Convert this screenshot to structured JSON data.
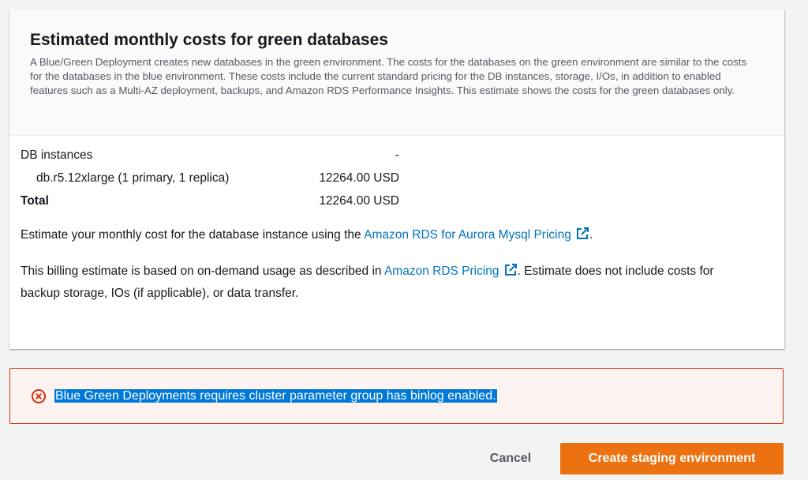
{
  "cost_panel": {
    "title": "Estimated monthly costs for green databases",
    "description": "A Blue/Green Deployment creates new databases in the green environment. The costs for the databases on the green environment are similar to the costs for the databases in the blue environment. These costs include the current standard pricing for the DB instances, storage, I/Os, in addition to enabled features such as a Multi-AZ deployment, backups, and Amazon RDS Performance Insights. This estimate shows the costs for the green databases only.",
    "rows": [
      {
        "label": "DB instances",
        "value": "-"
      },
      {
        "label": "db.r5.12xlarge (1 primary, 1 replica)",
        "value": "12264.00 USD"
      },
      {
        "label": "Total",
        "value": "12264.00 USD"
      }
    ],
    "estimate_text": "Estimate your monthly cost for the database instance using the",
    "estimate_link": "Amazon RDS for Aurora Mysql Pricing",
    "estimate_end": ".",
    "billing_text_before": "This billing estimate is based on on-demand usage as described in",
    "billing_link": "Amazon RDS Pricing",
    "billing_text_after": ". Estimate does not include costs for backup storage, IOs (if applicable), or data transfer.",
    "external_icon": "external-link-icon"
  },
  "alert": {
    "icon": "error-circle-x-icon",
    "message": "Blue Green Deployments requires cluster parameter group has binlog enabled."
  },
  "actions": {
    "cancel_label": "Cancel",
    "create_label": "Create staging environment"
  },
  "colors": {
    "link": "#0073bb",
    "primary": "#ec7211",
    "error": "#d13212",
    "selection": "#0078d7"
  }
}
